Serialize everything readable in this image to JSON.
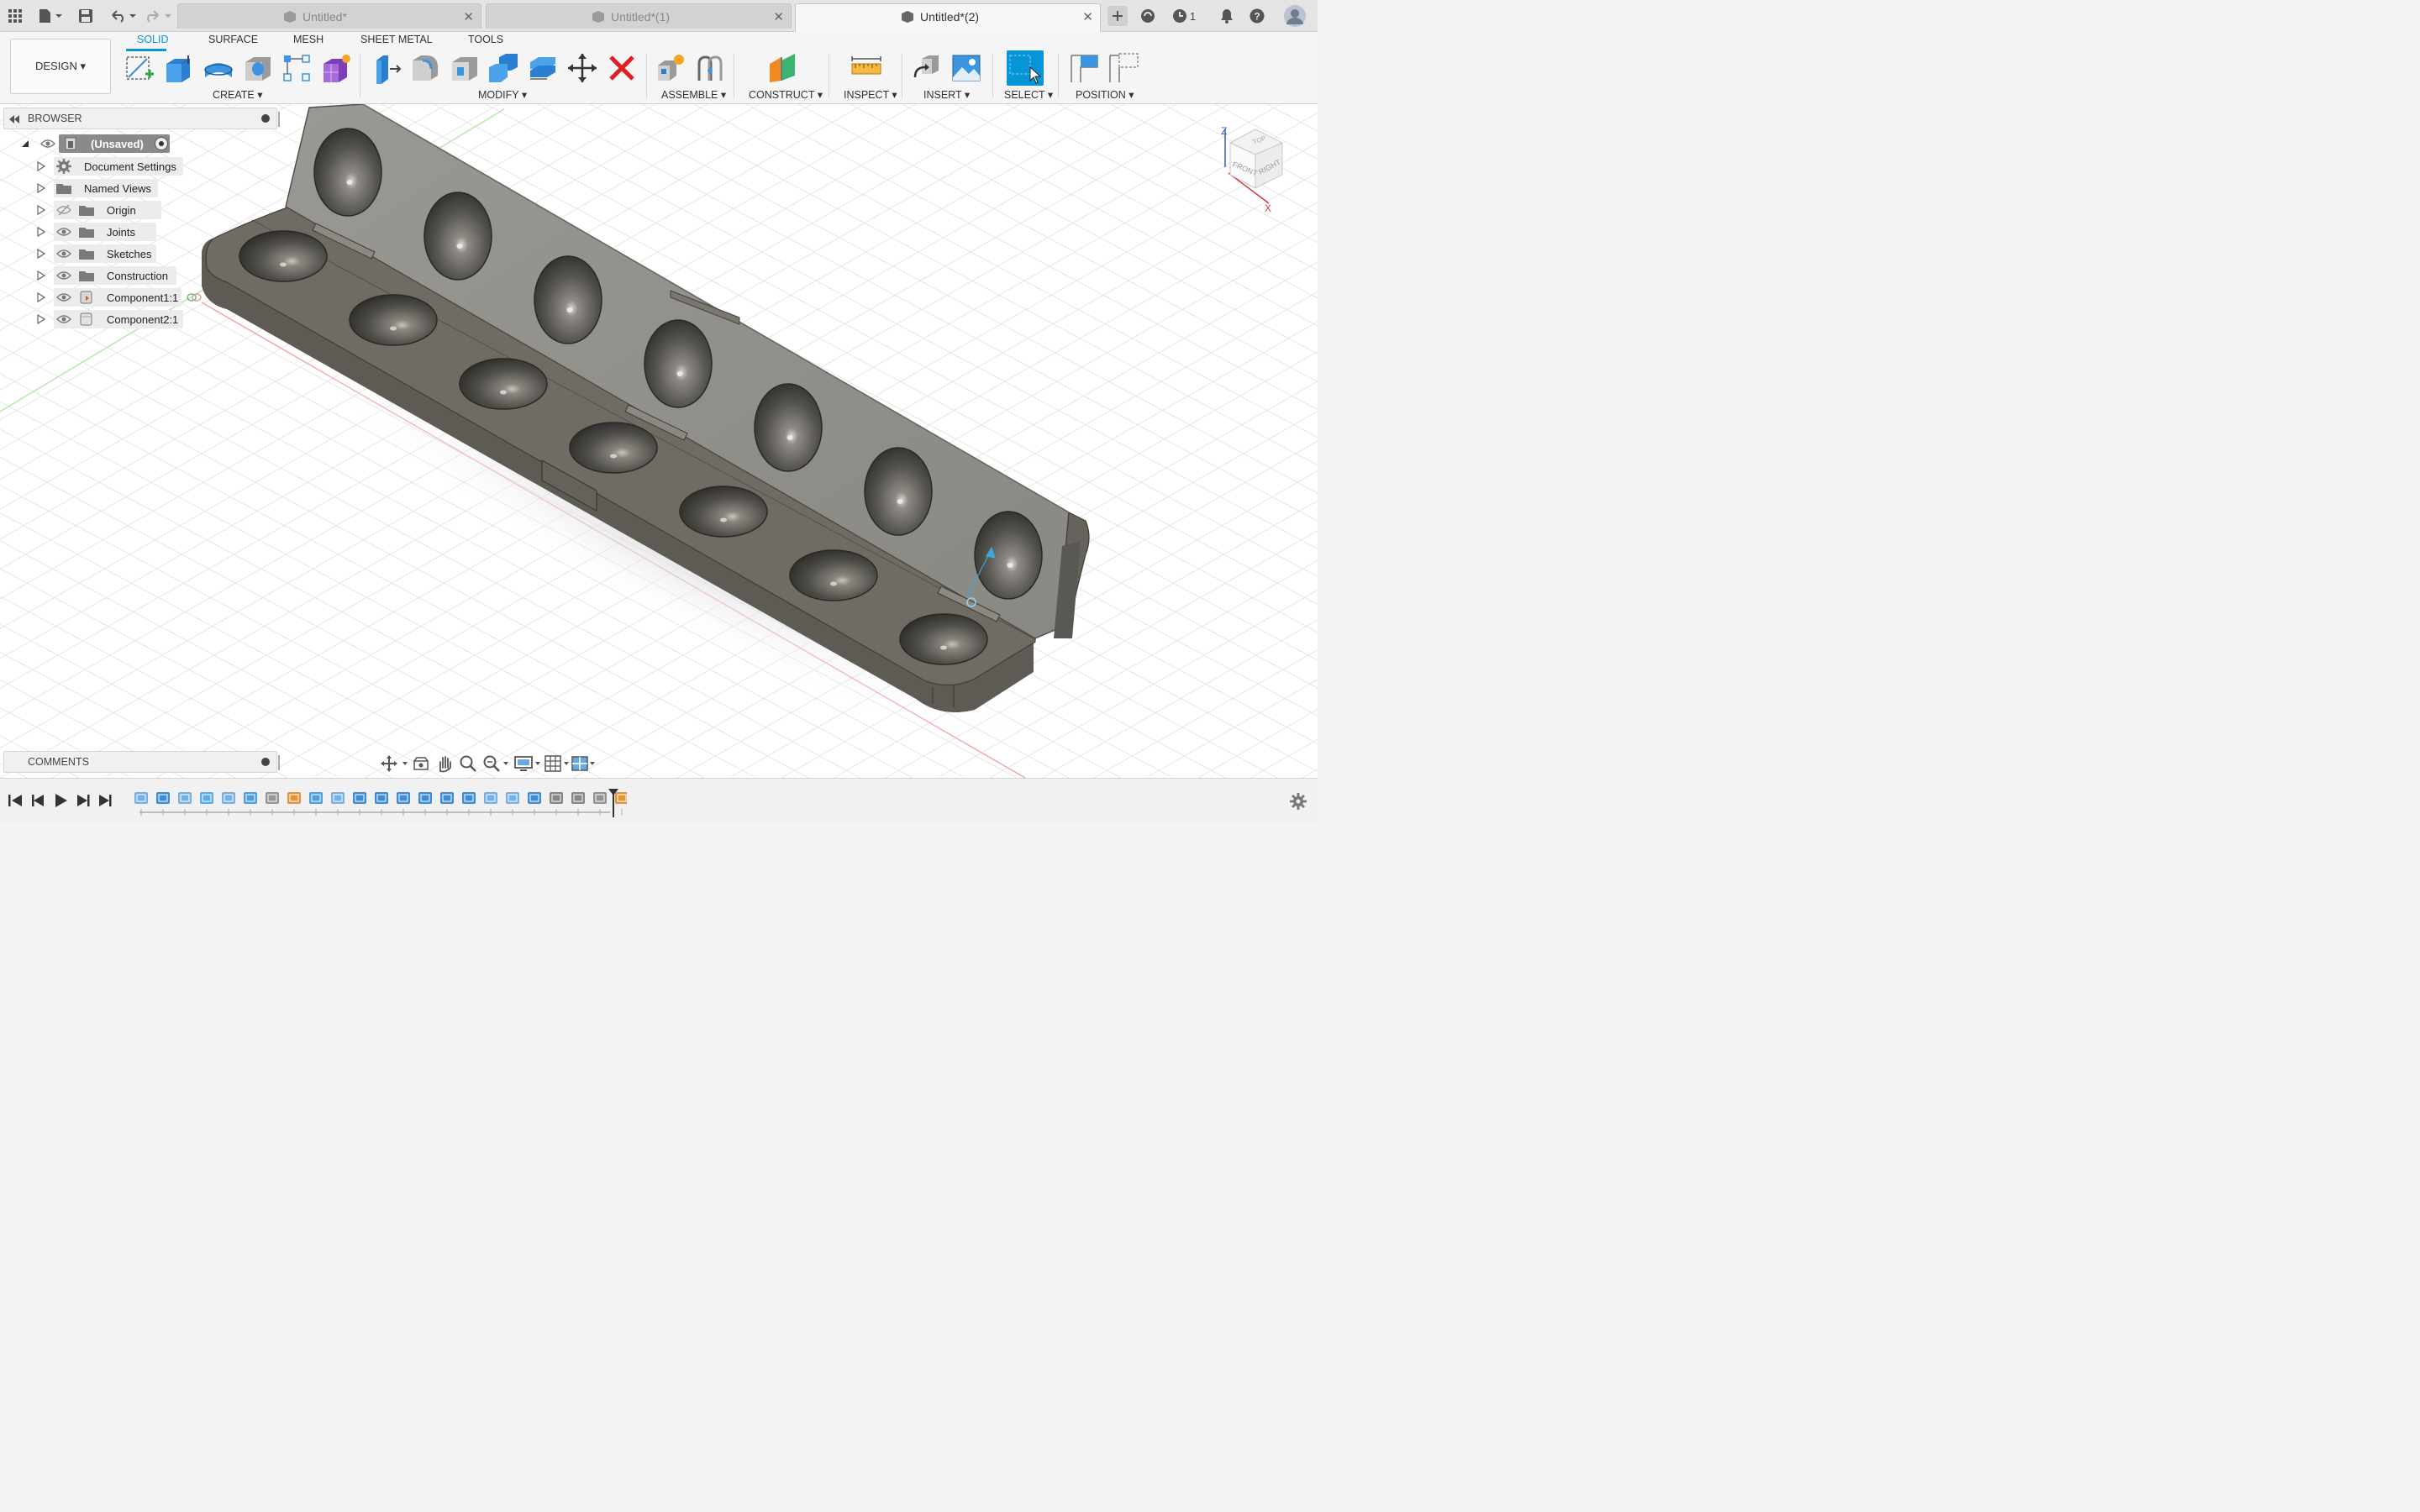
{
  "tabs": [
    {
      "label": "Untitled*",
      "active": false
    },
    {
      "label": "Untitled*(1)",
      "active": false
    },
    {
      "label": "Untitled*(2)",
      "active": true
    }
  ],
  "titlebar": {
    "job_count": "1",
    "icons": [
      "app-grid-icon",
      "file-icon",
      "save-icon",
      "undo-icon",
      "redo-icon",
      "new-tab-icon",
      "extensions-icon",
      "job-status-icon",
      "notifications-icon",
      "help-icon",
      "user-avatar-icon"
    ]
  },
  "workspace": {
    "label": "DESIGN ▾"
  },
  "ribbon_tabs": [
    "SOLID",
    "SURFACE",
    "MESH",
    "SHEET METAL",
    "TOOLS"
  ],
  "active_ribbon_tab": "SOLID",
  "tool_groups": {
    "create": "CREATE ▾",
    "modify": "MODIFY ▾",
    "assemble": "ASSEMBLE ▾",
    "construct": "CONSTRUCT ▾",
    "inspect": "INSPECT ▾",
    "insert": "INSERT ▾",
    "select": "SELECT ▾",
    "position": "POSITION ▾"
  },
  "browser": {
    "title": "BROWSER",
    "root": "(Unsaved)",
    "items": [
      {
        "label": "Document Settings",
        "icon": "gear-icon"
      },
      {
        "label": "Named Views",
        "icon": "folder-icon"
      },
      {
        "label": "Origin",
        "icon": "folder-icon",
        "hidden": true
      },
      {
        "label": "Joints",
        "icon": "folder-icon"
      },
      {
        "label": "Sketches",
        "icon": "folder-icon"
      },
      {
        "label": "Construction",
        "icon": "folder-icon"
      },
      {
        "label": "Component1:1",
        "icon": "component-icon"
      },
      {
        "label": "Component2:1",
        "icon": "component-icon"
      }
    ]
  },
  "viewcube": {
    "top": "TOP",
    "front": "FRONT",
    "right": "RIGHT",
    "axis_z": "Z",
    "axis_x": "X"
  },
  "comments": {
    "title": "COMMENTS"
  },
  "colors": {
    "accent": "#0696d7",
    "body": "#6e6b63",
    "lid": "#8a8780",
    "grid": "#e4e4e4"
  }
}
